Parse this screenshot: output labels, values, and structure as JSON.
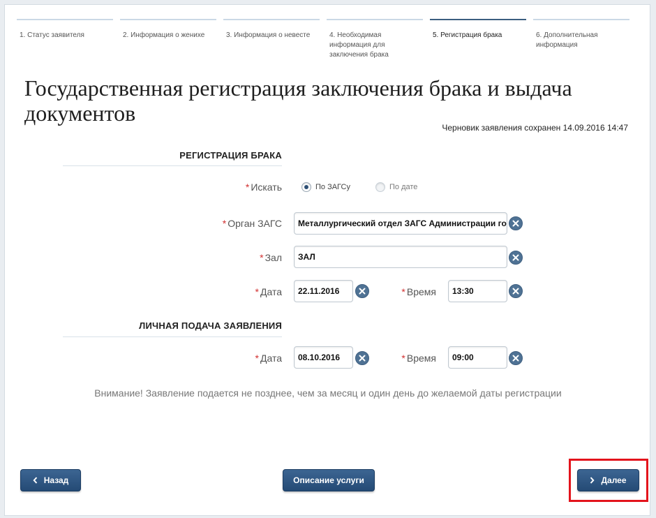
{
  "steps": [
    {
      "label": "1. Статус заявителя"
    },
    {
      "label": "2. Информация о женихе"
    },
    {
      "label": "3. Информация о невесте"
    },
    {
      "label": "4. Необходимая информация для заключения брака"
    },
    {
      "label": "5. Регистрация брака"
    },
    {
      "label": "6. Дополнительная информация"
    }
  ],
  "page": {
    "title": "Государственная регистрация заключения брака и выдача документов",
    "draft_status": "Черновик заявления сохранен 14.09.2016 14:47"
  },
  "registration": {
    "section_title": "РЕГИСТРАЦИЯ БРАКА",
    "search_label": "Искать",
    "search_options": [
      {
        "label": "По ЗАГСу",
        "checked": true
      },
      {
        "label": "По дате",
        "checked": false
      }
    ],
    "organ_label": "Орган ЗАГС",
    "organ_value": "Металлургический отдел ЗАГС Администрации город",
    "hall_label": "Зал",
    "hall_value": "ЗАЛ",
    "date_label": "Дата",
    "date_value": "22.11.2016",
    "time_label": "Время",
    "time_value": "13:30"
  },
  "submission": {
    "section_title": "ЛИЧНАЯ ПОДАЧА ЗАЯВЛЕНИЯ",
    "date_label": "Дата",
    "date_value": "08.10.2016",
    "time_label": "Время",
    "time_value": "09:00"
  },
  "notice": "Внимание! Заявление подается не позднее, чем за месяц и один день до желаемой даты регистрации",
  "buttons": {
    "back": "Назад",
    "description": "Описание услуги",
    "next": "Далее"
  },
  "colors": {
    "accent": "#2d4f74",
    "required": "#d23030",
    "highlight": "#e3141c"
  }
}
